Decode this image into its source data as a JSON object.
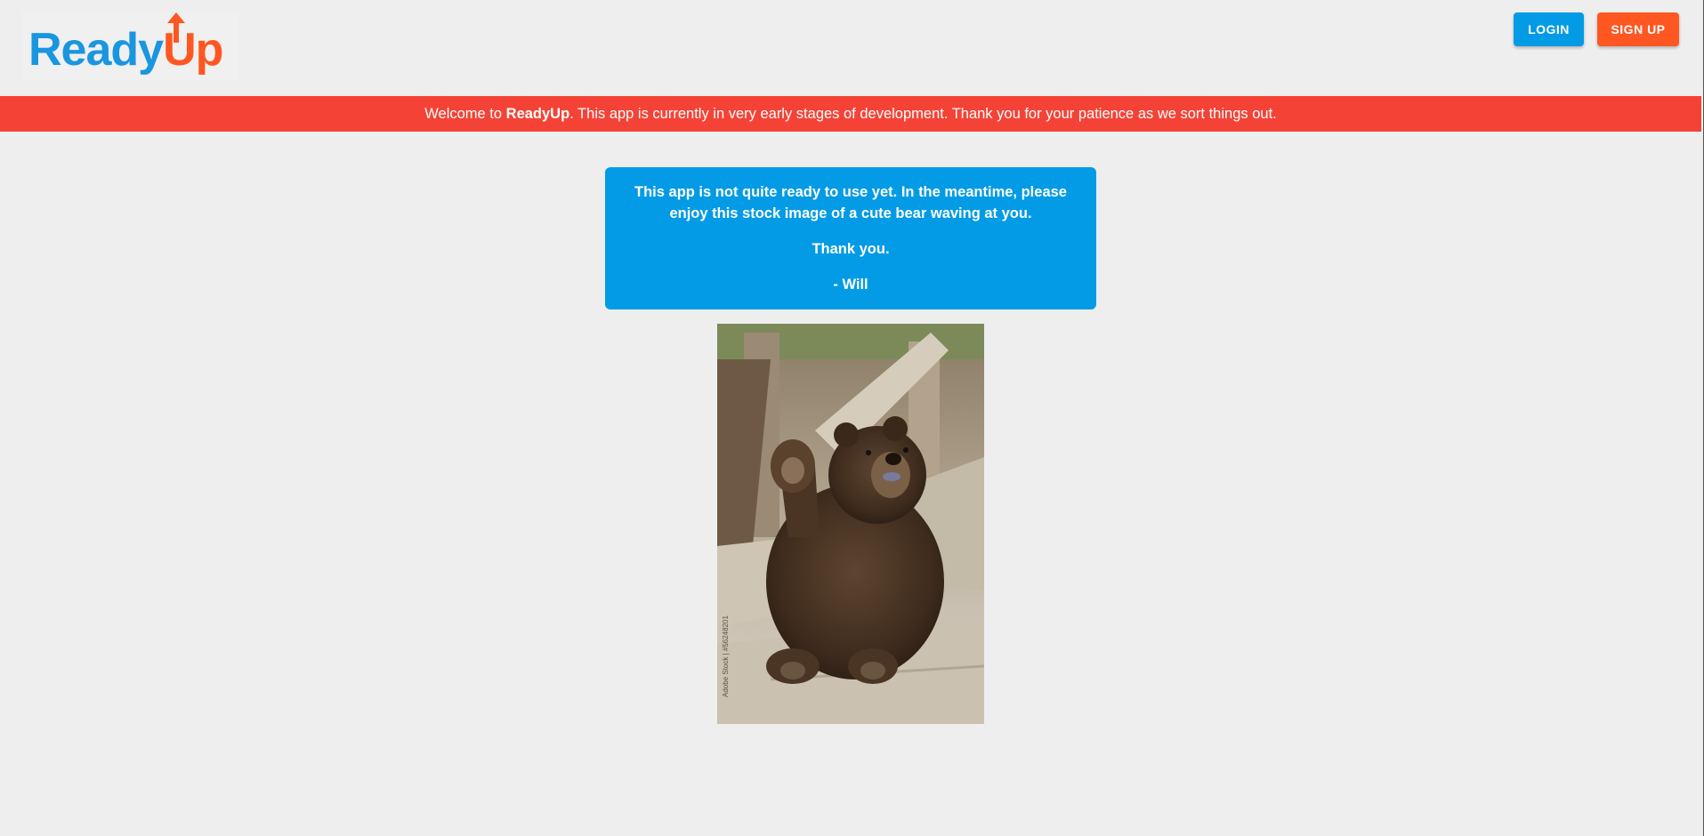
{
  "header": {
    "logo": {
      "part1": "Ready",
      "part2": "Up",
      "arrow_icon": "up-arrow-icon"
    },
    "login_label": "LOGIN",
    "signup_label": "SIGN UP"
  },
  "banner": {
    "prefix": "Welcome to ",
    "brand": "ReadyUp",
    "suffix": ". This app is currently in very early stages of development. Thank you for your patience as we sort things out."
  },
  "message": {
    "line1": "This app is not quite ready to use yet. In the meantime, please enjoy this stock image of a cute bear waving at you.",
    "line2": "Thank you.",
    "line3": "- Will"
  },
  "image": {
    "watermark": "Adobe Stock | #56248201"
  },
  "colors": {
    "blue": "#039be5",
    "orange": "#ff5722",
    "banner_red": "#f44336",
    "background": "#eeeeee"
  }
}
